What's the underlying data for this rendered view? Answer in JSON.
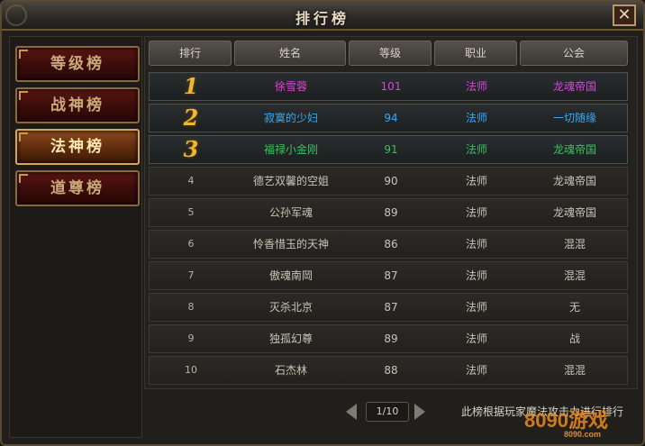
{
  "window": {
    "title": "排行榜",
    "close": "✕"
  },
  "sidebar": {
    "items": [
      {
        "label": "等级榜",
        "active": false
      },
      {
        "label": "战神榜",
        "active": false
      },
      {
        "label": "法神榜",
        "active": true
      },
      {
        "label": "道尊榜",
        "active": false
      }
    ]
  },
  "table": {
    "headers": [
      "排行",
      "姓名",
      "等级",
      "职业",
      "公会"
    ],
    "rows": [
      {
        "rank": "1",
        "name": "徐雪蓉",
        "level": "101",
        "class": "法师",
        "guild": "龙魂帝国",
        "color": "#d845d8"
      },
      {
        "rank": "2",
        "name": "寂寞的少妇",
        "level": "94",
        "class": "法师",
        "guild": "一切随缘",
        "color": "#3aa8f0"
      },
      {
        "rank": "3",
        "name": "福禄小金刚",
        "level": "91",
        "class": "法师",
        "guild": "龙魂帝国",
        "color": "#3fbf63"
      },
      {
        "rank": "4",
        "name": "德艺双馨的空姐",
        "level": "90",
        "class": "法师",
        "guild": "龙魂帝国",
        "color": "#c9c4b8"
      },
      {
        "rank": "5",
        "name": "公孙军魂",
        "level": "89",
        "class": "法师",
        "guild": "龙魂帝国",
        "color": "#c9c4b8"
      },
      {
        "rank": "6",
        "name": "怜香惜玉的天神",
        "level": "86",
        "class": "法师",
        "guild": "混混",
        "color": "#c9c4b8"
      },
      {
        "rank": "7",
        "name": "傲魂南岡",
        "level": "87",
        "class": "法师",
        "guild": "混混",
        "color": "#c9c4b8"
      },
      {
        "rank": "8",
        "name": "灭杀北京",
        "level": "87",
        "class": "法师",
        "guild": "无",
        "color": "#c9c4b8"
      },
      {
        "rank": "9",
        "name": "独孤幻尊",
        "level": "89",
        "class": "法师",
        "guild": "战",
        "color": "#c9c4b8"
      },
      {
        "rank": "10",
        "name": "石杰林",
        "level": "88",
        "class": "法师",
        "guild": "混混",
        "color": "#c9c4b8"
      }
    ]
  },
  "footer": {
    "page": "1/10",
    "note": "此榜根据玩家魔法攻击力进行排行"
  },
  "watermark": {
    "logo": "8090",
    "text": "游戏",
    "sub": "8090.com"
  }
}
